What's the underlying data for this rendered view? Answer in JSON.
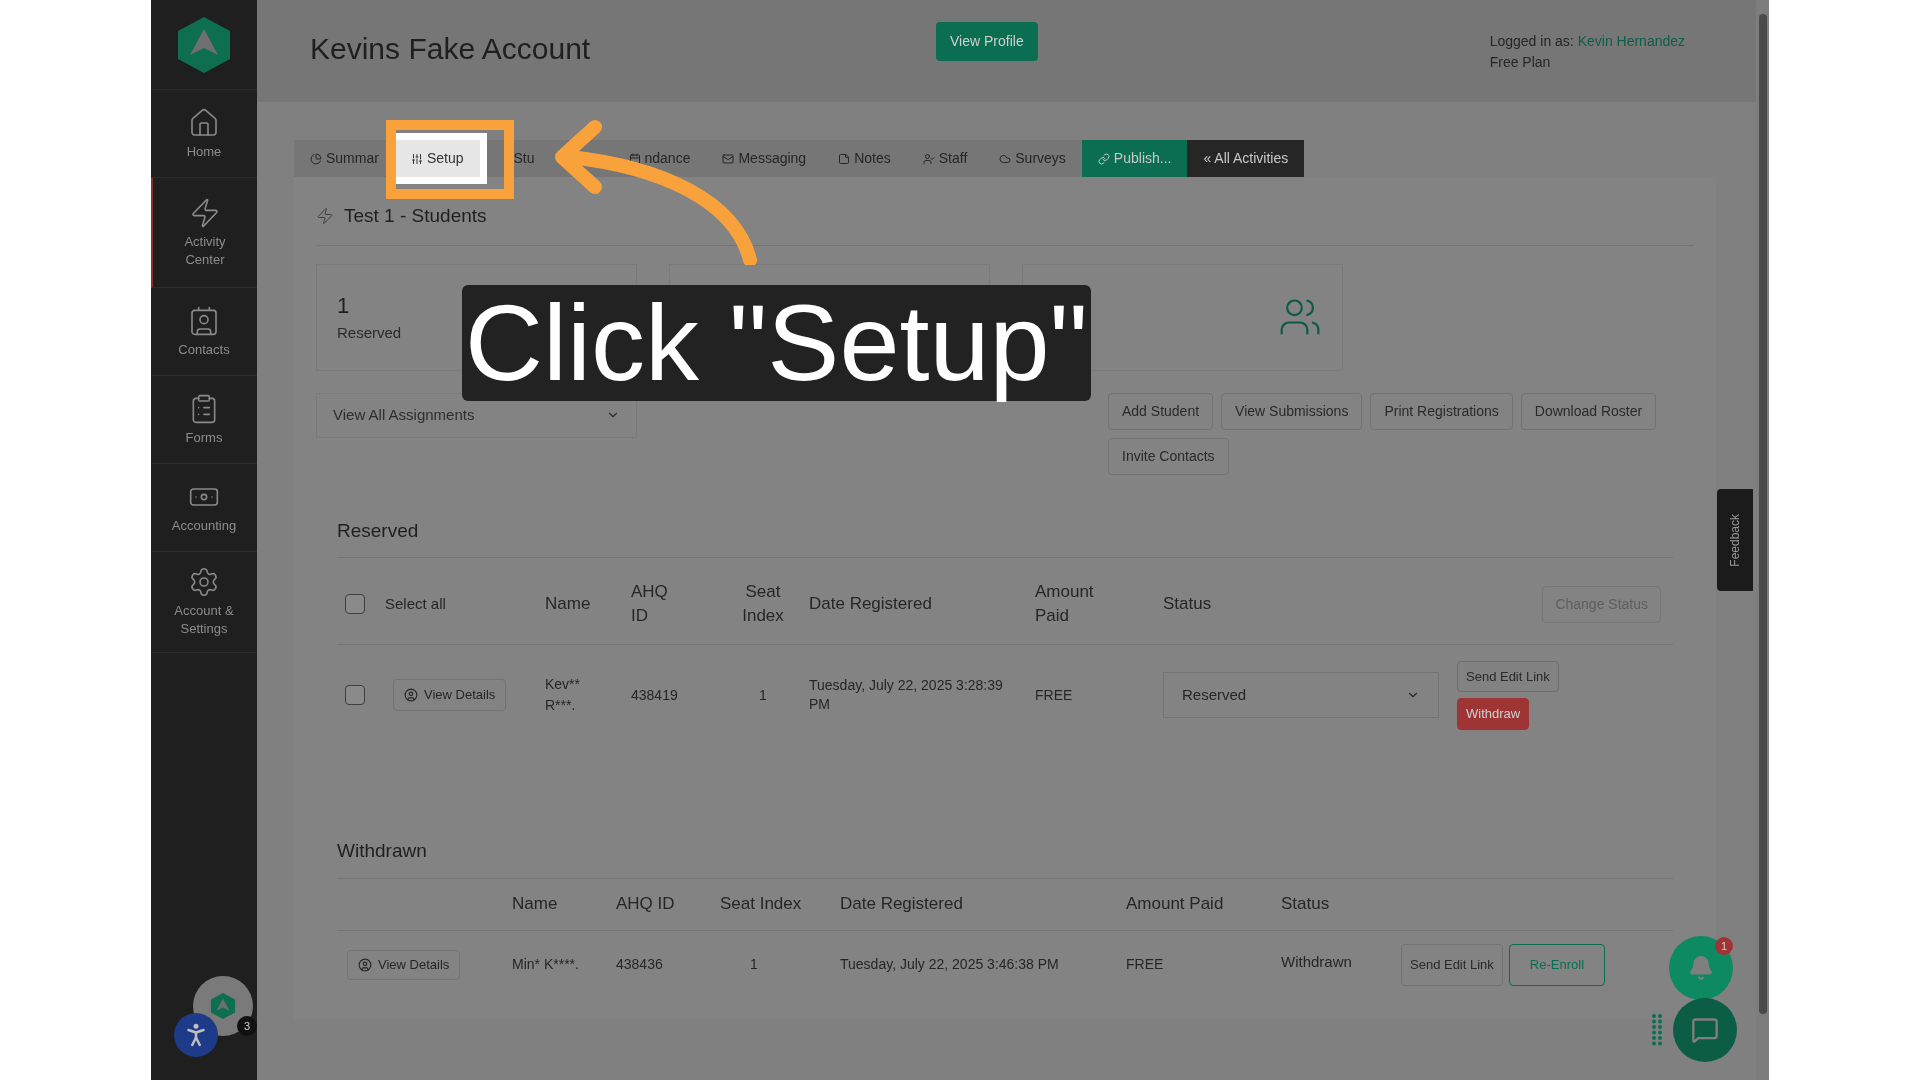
{
  "header": {
    "title": "Kevins Fake Account",
    "view_profile": "View Profile",
    "logged_in_label": "Logged in as:",
    "user": "Kevin Hernandez",
    "plan": "Free Plan"
  },
  "sidebar": {
    "items": [
      {
        "label": "Home",
        "selected": false
      },
      {
        "label": "Activity Center",
        "selected": true
      },
      {
        "label": "Contacts",
        "selected": false
      },
      {
        "label": "Forms",
        "selected": false
      },
      {
        "label": "Accounting",
        "selected": false
      },
      {
        "label": "Account & Settings",
        "selected": false
      }
    ]
  },
  "tabs": [
    {
      "label": "Summar",
      "selected": false,
      "kind": "plain"
    },
    {
      "label": "Setup",
      "selected": true,
      "kind": "plain"
    },
    {
      "label": "Stu",
      "selected": false,
      "kind": "plain"
    },
    {
      "label": "ndance",
      "selected": false,
      "kind": "plain"
    },
    {
      "label": "Messaging",
      "selected": false,
      "kind": "plain"
    },
    {
      "label": "Notes",
      "selected": false,
      "kind": "plain"
    },
    {
      "label": "Staff",
      "selected": false,
      "kind": "plain"
    },
    {
      "label": "Surveys",
      "selected": false,
      "kind": "plain"
    },
    {
      "label": "Publish...",
      "selected": false,
      "kind": "green"
    },
    {
      "label": "« All Activities",
      "selected": false,
      "kind": "dark"
    }
  ],
  "activity": {
    "title": "Test 1 - Students"
  },
  "stats": [
    {
      "kind": "summary",
      "count": "1",
      "label": "Reserved"
    },
    {
      "kind": "covered"
    },
    {
      "kind": "icon"
    }
  ],
  "assignments_select": {
    "value": "View All Assignments"
  },
  "actions": [
    "Add Student",
    "View Submissions",
    "Print Registrations",
    "Download Roster",
    "Invite Contacts"
  ],
  "reserved": {
    "heading": "Reserved",
    "select_all": "Select all",
    "select_all_checked": false,
    "change_status": "Change Status",
    "columns": [
      "Name",
      "AHQ ID",
      "Seat Index",
      "Date Registered",
      "Amount Paid",
      "Status"
    ],
    "rows": [
      {
        "checked": false,
        "view_details": "View Details",
        "name": "Kev** R***.",
        "ahq_id": "438419",
        "seat_index": "1",
        "date": "Tuesday, July 22, 2025 3:28:39 PM",
        "amount": "FREE",
        "status": "Reserved",
        "send_edit_link": "Send Edit Link",
        "withdraw": "Withdraw"
      }
    ]
  },
  "withdrawn": {
    "heading": "Withdrawn",
    "columns": [
      "Name",
      "AHQ ID",
      "Seat Index",
      "Date Registered",
      "Amount Paid",
      "Status"
    ],
    "rows": [
      {
        "view_details": "View Details",
        "name": "Min* K****.",
        "ahq_id": "438436",
        "seat_index": "1",
        "date": "Tuesday, July 22, 2025 3:46:38 PM",
        "amount": "FREE",
        "status": "Withdrawn",
        "send_edit_link": "Send Edit Link",
        "re_enroll": "Re-Enroll"
      }
    ]
  },
  "feedback": "Feedback",
  "notifications": {
    "count": "1"
  },
  "avatar_badge": "3",
  "tutorial": {
    "callout": "Click \"Setup\""
  }
}
